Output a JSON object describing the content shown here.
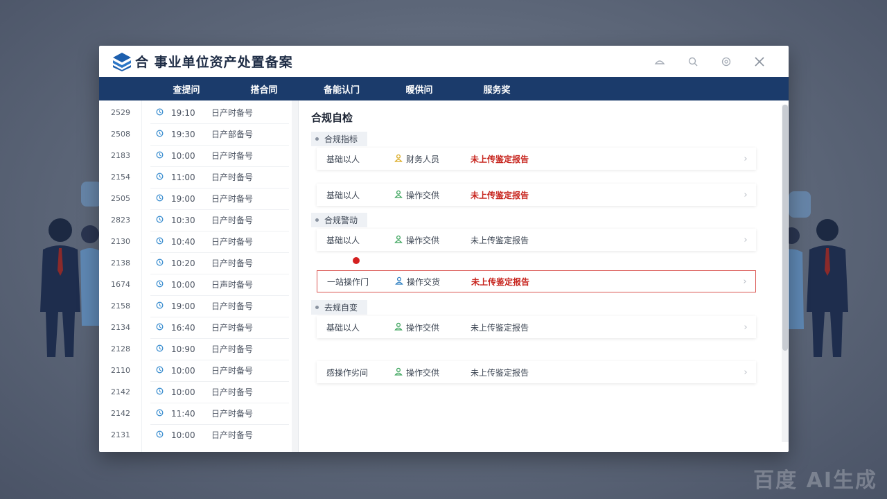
{
  "app": {
    "title": "合 事业单位资产处置备案"
  },
  "colors": {
    "nav_bg": "#1b3b6b",
    "warn": "#c7241d",
    "accent": "#3d8fd0",
    "selected_border": "#d9534f"
  },
  "window_controls": [
    "minimize-icon",
    "search-icon",
    "settings-icon",
    "close-icon"
  ],
  "nav": [
    "查提问",
    "搭合同",
    "备能认门",
    "暖供问",
    "服务奖"
  ],
  "left_list": [
    {
      "id": "2529",
      "time": "19:10",
      "name": "日产时备号"
    },
    {
      "id": "2508",
      "time": "19:30",
      "name": "日产部备号"
    },
    {
      "id": "2183",
      "time": "10:00",
      "name": "日产时备号"
    },
    {
      "id": "2154",
      "time": "11:00",
      "name": "日产时备号"
    },
    {
      "id": "2505",
      "time": "19:00",
      "name": "日产时备号"
    },
    {
      "id": "2823",
      "time": "10:30",
      "name": "日产时备号"
    },
    {
      "id": "2130",
      "time": "10:40",
      "name": "日产时备号"
    },
    {
      "id": "2138",
      "time": "10:20",
      "name": "日产时备号"
    },
    {
      "id": "1674",
      "time": "10:00",
      "name": "日声时备号"
    },
    {
      "id": "2158",
      "time": "19:00",
      "name": "日产时备号"
    },
    {
      "id": "2134",
      "time": "16:40",
      "name": "日产时备号"
    },
    {
      "id": "2128",
      "time": "10:90",
      "name": "日产时备号"
    },
    {
      "id": "2110",
      "time": "10:00",
      "name": "日产时备号"
    },
    {
      "id": "2142",
      "time": "10:00",
      "name": "日产时备号"
    },
    {
      "id": "2142",
      "time": "11:40",
      "name": "日产时备号"
    },
    {
      "id": "2131",
      "time": "10:00",
      "name": "日产时备号"
    }
  ],
  "main": {
    "title": "合规自检",
    "groups": [
      {
        "label": "合规指标",
        "items": [
          {
            "name": "基础以人",
            "role": "财务人员",
            "role_color": "#d9a91f",
            "status": "未上传鉴定报告",
            "warn": true
          },
          {
            "name": "基础以人",
            "role": "操作交供",
            "role_color": "#3aa35b",
            "status": "未上传鉴定报告",
            "warn": true
          }
        ]
      },
      {
        "label": "合规警动",
        "items": [
          {
            "name": "基础以人",
            "role": "操作交供",
            "role_color": "#3aa35b",
            "status": "未上传鉴定报告",
            "warn": false
          },
          {
            "name": "一站操作门",
            "role": "操作交货",
            "role_color": "#2f7fc1",
            "status": "未上传鉴定报告",
            "warn": true,
            "selected": true
          }
        ]
      },
      {
        "label": "去规自变",
        "items": [
          {
            "name": "基础以人",
            "role": "操作交供",
            "role_color": "#3aa35b",
            "status": "未上传鉴定报告",
            "warn": false
          },
          {
            "name": "感操作劣间",
            "role": "操作交供",
            "role_color": "#3aa35b",
            "status": "未上传鉴定报告",
            "warn": false
          }
        ]
      }
    ]
  },
  "watermark": "百度 AI生成"
}
